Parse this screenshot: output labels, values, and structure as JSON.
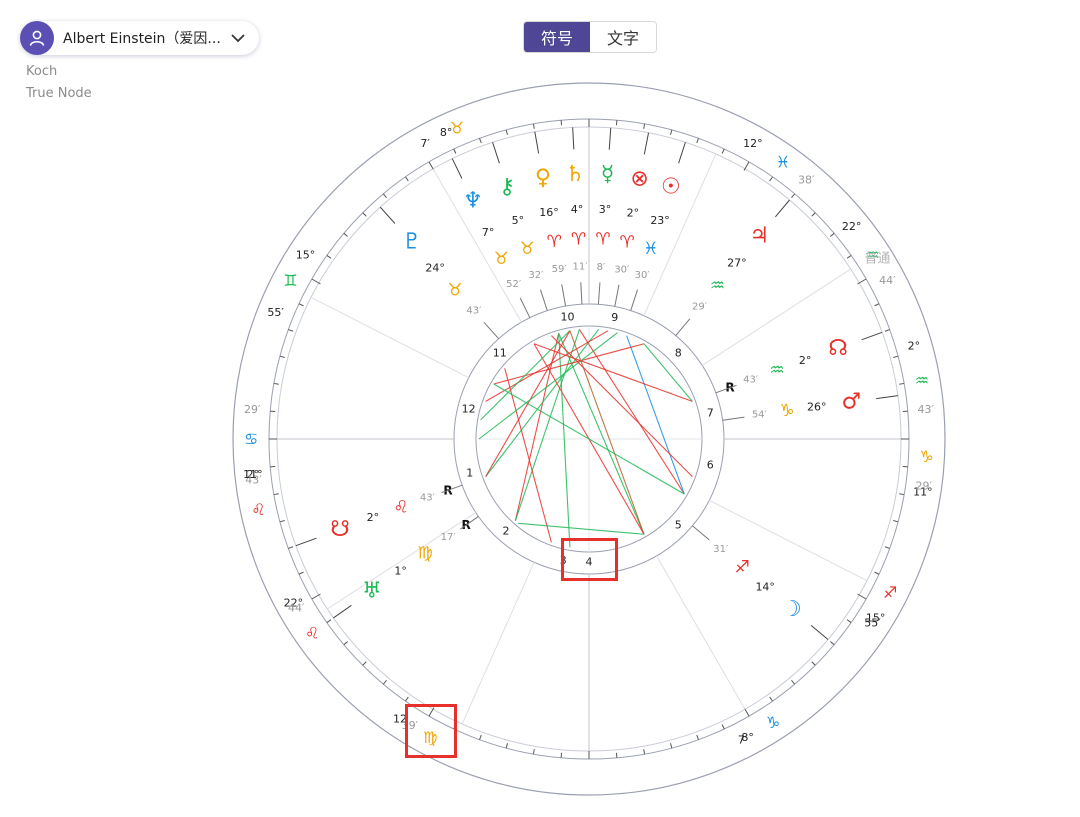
{
  "header": {
    "profile_name": "Albert Einstein（爱因...",
    "house_system": "Koch",
    "node_type": "True Node",
    "view_toggle": [
      "符号",
      "文字"
    ],
    "active_view": "符号"
  },
  "chart_data": {
    "type": "natal-wheel",
    "outer_label": "普通",
    "zodiac_ring": [
      {
        "deg": "7′",
        "sign": "♉",
        "color": "#f0a500"
      },
      {
        "deg": "8°",
        "sign": "",
        "color": "#222"
      },
      {
        "deg": "12°",
        "sign": "♓",
        "color": "#1a8fe0"
      },
      {
        "deg": "38′",
        "sign": "",
        "color": "#999"
      },
      {
        "deg": "22°",
        "sign": "♒",
        "color": "#1db954"
      },
      {
        "deg": "44′",
        "sign": "",
        "color": "#999"
      },
      {
        "deg": "2°",
        "sign": "♒",
        "color": "#1db954"
      },
      {
        "deg": "43′",
        "sign": "",
        "color": "#999"
      },
      {
        "deg": "11°",
        "sign": "♑",
        "color": "#f0a500"
      },
      {
        "deg": "29′",
        "sign": "",
        "color": "#999"
      },
      {
        "deg": "55′",
        "sign": "♐",
        "color": "#e8302a"
      },
      {
        "deg": "15°",
        "sign": "",
        "color": "#222"
      },
      {
        "deg": "7′",
        "sign": "♑",
        "color": "#1a8fe0"
      },
      {
        "deg": "8°",
        "sign": "",
        "color": "#222"
      },
      {
        "deg": "12",
        "sign": "♍",
        "color": "#f0a500"
      },
      {
        "deg": "39′",
        "sign": "",
        "color": "#999"
      },
      {
        "deg": "22°",
        "sign": "♌",
        "color": "#e8302a"
      },
      {
        "deg": "44′",
        "sign": "",
        "color": "#999"
      },
      {
        "deg": "2°",
        "sign": "♌",
        "color": "#e8302a"
      },
      {
        "deg": "43′",
        "sign": "",
        "color": "#999"
      },
      {
        "deg": "11°",
        "sign": "♋",
        "color": "#1a8fe0"
      },
      {
        "deg": "29′",
        "sign": "",
        "color": "#999"
      },
      {
        "deg": "55′",
        "sign": "♊",
        "color": "#1db954"
      },
      {
        "deg": "15°",
        "sign": "",
        "color": "#222"
      }
    ],
    "planets": [
      {
        "name": "neptune",
        "glyph": "♆",
        "color": "#1a8fe0",
        "deg": "7°",
        "sign": "♉",
        "sign_color": "#f0a500",
        "min": "52′",
        "retro": ""
      },
      {
        "name": "chiron",
        "glyph": "⚷",
        "color": "#1db954",
        "deg": "5°",
        "sign": "♉",
        "sign_color": "#f0a500",
        "min": "32′",
        "retro": ""
      },
      {
        "name": "venus",
        "glyph": "♀",
        "color": "#f0a500",
        "deg": "16°",
        "sign": "♈",
        "sign_color": "#e8302a",
        "min": "59′",
        "retro": ""
      },
      {
        "name": "saturn",
        "glyph": "♄",
        "color": "#f0a500",
        "deg": "4°",
        "sign": "♈",
        "sign_color": "#e8302a",
        "min": "11′",
        "retro": ""
      },
      {
        "name": "mercury",
        "glyph": "☿",
        "color": "#1db954",
        "deg": "3°",
        "sign": "♈",
        "sign_color": "#e8302a",
        "min": "8′",
        "retro": ""
      },
      {
        "name": "fortune",
        "glyph": "⊗",
        "color": "#e8302a",
        "deg": "2°",
        "sign": "♈",
        "sign_color": "#e8302a",
        "min": "30′",
        "retro": ""
      },
      {
        "name": "sun",
        "glyph": "☉",
        "color": "#e8302a",
        "deg": "23°",
        "sign": "♓",
        "sign_color": "#1a8fe0",
        "min": "30′",
        "retro": ""
      },
      {
        "name": "jupiter",
        "glyph": "♃",
        "color": "#e8302a",
        "deg": "27°",
        "sign": "♒",
        "sign_color": "#1db954",
        "min": "29′",
        "retro": ""
      },
      {
        "name": "pluto",
        "glyph": "♇",
        "color": "#1a8fe0",
        "deg": "24°",
        "sign": "♉",
        "sign_color": "#f0a500",
        "min": "43′",
        "retro": ""
      },
      {
        "name": "north-node",
        "glyph": "☊",
        "color": "#e8302a",
        "deg": "2°",
        "sign": "♒",
        "sign_color": "#1db954",
        "min": "43′",
        "retro": "R"
      },
      {
        "name": "mars",
        "glyph": "♂",
        "color": "#e8302a",
        "deg": "26°",
        "sign": "♑",
        "sign_color": "#f0a500",
        "min": "54′",
        "retro": ""
      },
      {
        "name": "moon",
        "glyph": "☽",
        "color": "#1a8fe0",
        "deg": "14°",
        "sign": "♐",
        "sign_color": "#e8302a",
        "min": "31′",
        "retro": ""
      },
      {
        "name": "south-node",
        "glyph": "☋",
        "color": "#e8302a",
        "deg": "2°",
        "sign": "♌",
        "sign_color": "#e8302a",
        "min": "43′",
        "retro": "R"
      },
      {
        "name": "uranus",
        "glyph": "♅",
        "color": "#1db954",
        "deg": "1°",
        "sign": "♍",
        "sign_color": "#f0a500",
        "min": "17′",
        "retro": "R"
      }
    ],
    "houses": [
      "1",
      "2",
      "3",
      "4",
      "5",
      "6",
      "7",
      "8",
      "9",
      "10",
      "11",
      "12"
    ],
    "highlighted_house": "4"
  }
}
